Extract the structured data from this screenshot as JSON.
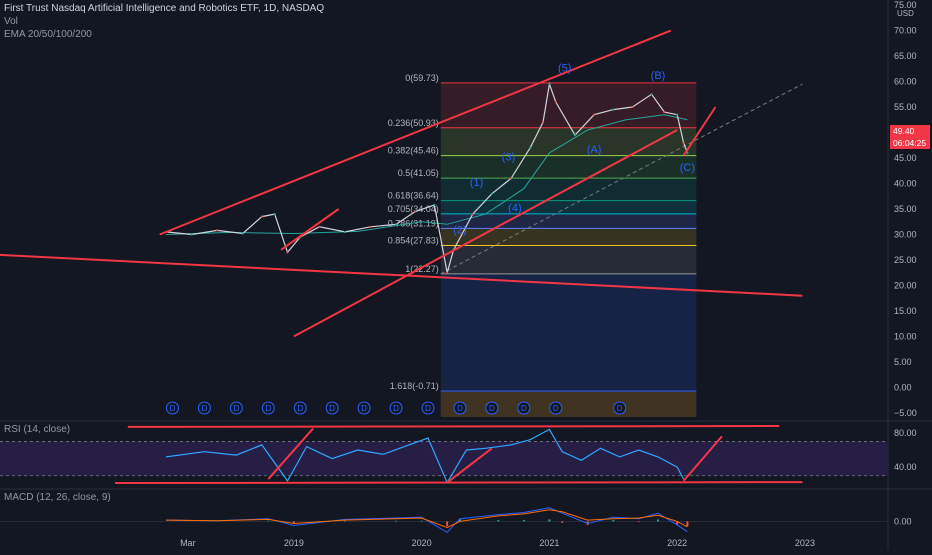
{
  "header": {
    "title": "First Trust Nasdaq Artificial Intelligence and Robotics ETF, 1D, NASDAQ",
    "vol_label": "Vol",
    "ema_label": "EMA 20/50/100/200",
    "currency": "USD"
  },
  "price_marker": {
    "value": "49.40",
    "countdown": "06:04:25"
  },
  "panes": {
    "rsi_label": "RSI (14, close)",
    "macd_label": "MACD (12, 26, close, 9)"
  },
  "colors": {
    "background": "#131722",
    "trendline": "#f23645",
    "price": "#d1d4dc",
    "rsi": "#2ea8ff",
    "rsi_band": "#2a1f4a",
    "wave_label": "#2962ff"
  },
  "chart_data": [
    {
      "type": "line",
      "name": "price",
      "yaxis": {
        "ticks": [
          75,
          70,
          65,
          60,
          55,
          50,
          45,
          40,
          35,
          30,
          25,
          20,
          15,
          10,
          5,
          0,
          -5
        ],
        "tick_labels": [
          "75.00",
          "70.00",
          "65.00",
          "60.00",
          "55.00",
          "50.00",
          "45.00",
          "40.00",
          "35.00",
          "30.00",
          "25.00",
          "20.00",
          "15.00",
          "10.00",
          "5.00",
          "0.00",
          "−5.00"
        ],
        "ylim": [
          -6,
          76
        ]
      },
      "xaxis": {
        "ticks": [
          "Mar",
          "2019",
          "2020",
          "2021",
          "2022",
          "2023"
        ],
        "tick_years": [
          2018.17,
          2019.0,
          2020.0,
          2021.0,
          2022.0,
          2023.0
        ],
        "xlim": [
          2016.7,
          2023.65
        ]
      },
      "x": [
        2018.0,
        2018.2,
        2018.4,
        2018.6,
        2018.75,
        2018.85,
        2018.95,
        2019.05,
        2019.2,
        2019.4,
        2019.6,
        2019.8,
        2019.95,
        2020.1,
        2020.2,
        2020.25,
        2020.4,
        2020.55,
        2020.7,
        2020.85,
        2020.95,
        2021.0,
        2021.05,
        2021.2,
        2021.35,
        2021.5,
        2021.65,
        2021.8,
        2021.9,
        2022.0,
        2022.05,
        2022.08
      ],
      "y": [
        30.5,
        30.0,
        30.8,
        30.2,
        33.5,
        34.0,
        26.5,
        29.5,
        31.5,
        30.5,
        31.5,
        32.0,
        34.5,
        35.8,
        22.5,
        27.0,
        34.0,
        38.0,
        41.0,
        47.0,
        52.0,
        59.5,
        56.0,
        49.5,
        53.5,
        54.5,
        55.0,
        57.5,
        54.0,
        53.5,
        48.0,
        46.0
      ],
      "ema_slow": {
        "x": [
          2018.0,
          2018.5,
          2019.0,
          2019.5,
          2020.0,
          2020.2,
          2020.5,
          2020.8,
          2021.0,
          2021.3,
          2021.6,
          2021.9,
          2022.08
        ],
        "y": [
          30.0,
          30.4,
          30.2,
          30.6,
          32.5,
          32.0,
          34.0,
          39.0,
          46.0,
          50.5,
          52.5,
          53.5,
          52.5
        ]
      },
      "fib_levels": [
        {
          "label": "0(59.73)",
          "ratio": "0",
          "value": 59.73,
          "color": "#f23645"
        },
        {
          "label": "0.236(50.93)",
          "ratio": "0.236",
          "value": 50.93,
          "color": "#f23645"
        },
        {
          "label": "0.382(45.46)",
          "ratio": "0.382",
          "value": 45.46,
          "color": "#9ad24b"
        },
        {
          "label": "0.5(41.05)",
          "ratio": "0.5",
          "value": 41.05,
          "color": "#4caf50"
        },
        {
          "label": "0.618(36.64)",
          "ratio": "0.618",
          "value": 36.64,
          "color": "#089981"
        },
        {
          "label": "0.705(34.04)",
          "ratio": "0.705",
          "value": 34.04,
          "color": "#00bcd4"
        },
        {
          "label": "0.786(31.19)",
          "ratio": "0.786",
          "value": 31.19,
          "color": "#5b7fff"
        },
        {
          "label": "0.854(27.83)",
          "ratio": "0.854",
          "value": 27.83,
          "color": "#f3c623"
        },
        {
          "label": "1(22.27)",
          "ratio": "1",
          "value": 22.27,
          "color": "#9598a1"
        },
        {
          "label": "1.618(-0.71)",
          "ratio": "1.618",
          "value": -0.71,
          "color": "#2962ff"
        }
      ],
      "fib_range_x": [
        2020.15,
        2022.15
      ],
      "wave_labels": [
        {
          "text": "(1)",
          "x": 2020.43,
          "y": 39.5
        },
        {
          "text": "(2)",
          "x": 2020.3,
          "y": 30.2
        },
        {
          "text": "(3)",
          "x": 2020.68,
          "y": 44.5
        },
        {
          "text": "(4)",
          "x": 2020.73,
          "y": 34.5
        },
        {
          "text": "(5)",
          "x": 2021.12,
          "y": 62.0
        },
        {
          "text": "(A)",
          "x": 2021.35,
          "y": 46.0
        },
        {
          "text": "(B)",
          "x": 2021.85,
          "y": 60.5
        },
        {
          "text": "(C)",
          "x": 2022.08,
          "y": 42.5
        }
      ],
      "dividends_x": [
        2018.05,
        2018.3,
        2018.55,
        2018.8,
        2019.05,
        2019.3,
        2019.55,
        2019.8,
        2020.05,
        2020.3,
        2020.55,
        2020.8,
        2021.05,
        2021.55
      ],
      "trendlines": [
        {
          "x": [
            2017.95,
            2021.95
          ],
          "y": [
            30.0,
            70.0
          ]
        },
        {
          "x": [
            2019.0,
            2022.0
          ],
          "y": [
            10.0,
            50.5
          ]
        },
        {
          "x": [
            2016.7,
            2022.98
          ],
          "y": [
            26.0,
            18.0
          ]
        },
        {
          "x": [
            2018.9,
            2019.35
          ],
          "y": [
            27.0,
            35.0
          ]
        },
        {
          "x": [
            2022.05,
            2022.3
          ],
          "y": [
            45.5,
            55.0
          ]
        }
      ],
      "dashed_line": {
        "x": [
          2020.15,
          2022.98
        ],
        "y": [
          22.27,
          59.5
        ]
      }
    },
    {
      "type": "line",
      "name": "RSI (14, close)",
      "yaxis": {
        "ticks": [
          80,
          40
        ],
        "tick_labels": [
          "80.00",
          "40.00"
        ],
        "ylim": [
          18,
          88
        ],
        "band": [
          30,
          70
        ]
      },
      "x": [
        2018.0,
        2018.3,
        2018.55,
        2018.75,
        2018.95,
        2019.1,
        2019.3,
        2019.5,
        2019.7,
        2019.9,
        2020.05,
        2020.2,
        2020.35,
        2020.5,
        2020.7,
        2020.85,
        2021.0,
        2021.1,
        2021.25,
        2021.4,
        2021.55,
        2021.7,
        2021.85,
        2022.0,
        2022.05
      ],
      "y": [
        52,
        58,
        54,
        66,
        24,
        64,
        50,
        60,
        55,
        66,
        74,
        22,
        60,
        62,
        66,
        72,
        84,
        58,
        48,
        62,
        52,
        60,
        52,
        40,
        26
      ],
      "trendlines": [
        {
          "x": [
            2017.7,
            2022.8
          ],
          "y": [
            87,
            88
          ]
        },
        {
          "x": [
            2017.6,
            2022.98
          ],
          "y": [
            21.5,
            22.5
          ]
        },
        {
          "x": [
            2018.8,
            2019.15
          ],
          "y": [
            26,
            85
          ]
        },
        {
          "x": [
            2020.2,
            2020.55
          ],
          "y": [
            22,
            62
          ]
        },
        {
          "x": [
            2022.05,
            2022.35
          ],
          "y": [
            24,
            76
          ]
        }
      ]
    },
    {
      "type": "line",
      "name": "MACD (12, 26, close, 9)",
      "yaxis": {
        "ticks": [
          0
        ],
        "tick_labels": [
          "0.00"
        ],
        "ylim": [
          -3,
          4
        ]
      },
      "x": [
        2018.0,
        2018.4,
        2018.8,
        2019.0,
        2019.4,
        2019.8,
        2020.0,
        2020.2,
        2020.3,
        2020.6,
        2020.8,
        2021.0,
        2021.1,
        2021.3,
        2021.5,
        2021.7,
        2021.85,
        2022.0,
        2022.08
      ],
      "y": [
        0.2,
        0.1,
        0.4,
        -0.6,
        0.3,
        0.5,
        0.6,
        -1.6,
        0.4,
        1.0,
        1.3,
        2.0,
        1.2,
        -0.3,
        0.6,
        0.4,
        1.2,
        -0.5,
        -1.5
      ],
      "signal": [
        0.2,
        0.1,
        0.3,
        -0.3,
        0.2,
        0.4,
        0.5,
        -0.9,
        0.0,
        0.8,
        1.1,
        1.7,
        1.4,
        0.2,
        0.4,
        0.5,
        0.9,
        0.0,
        -0.8
      ]
    }
  ]
}
